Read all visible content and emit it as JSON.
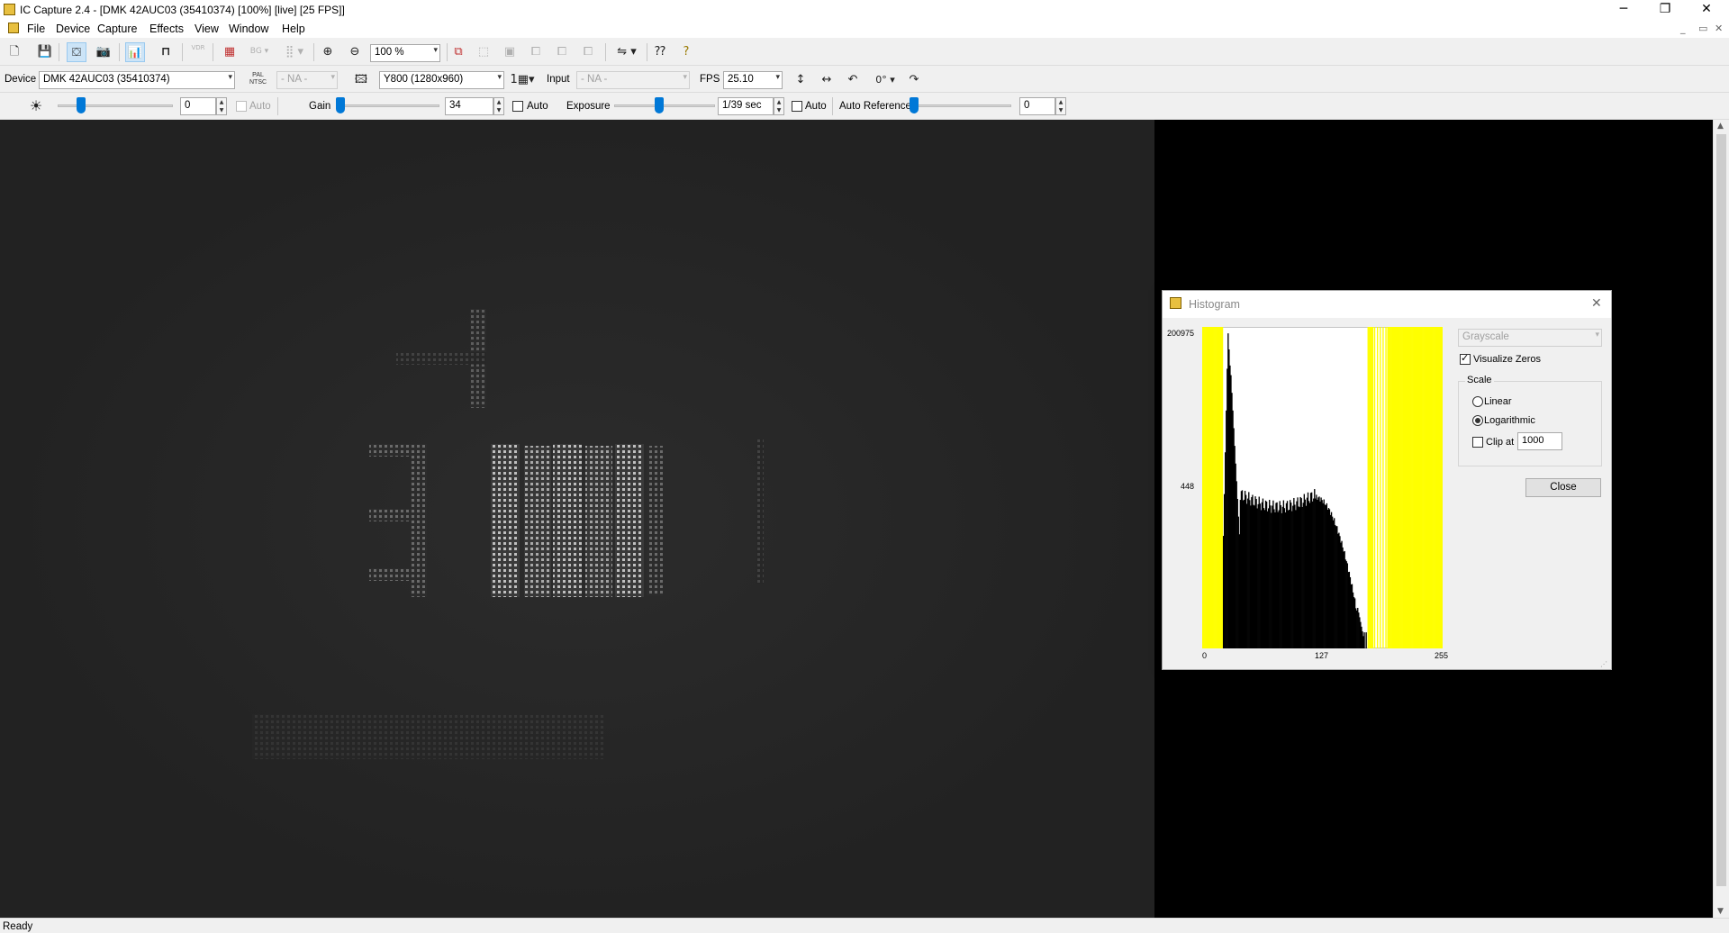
{
  "window": {
    "title": "IC Capture 2.4 - [DMK 42AUC03 (35410374) [100%]  [live]  [25 FPS]]",
    "minimize_glyph": "─",
    "maximize_glyph": "❐",
    "close_glyph": "✕"
  },
  "menu": {
    "items": [
      "File",
      "Device",
      "Capture",
      "Effects",
      "View",
      "Window",
      "Help"
    ],
    "mdi_minimize": "_",
    "mdi_restore": "▭",
    "mdi_close": "✕"
  },
  "toolbar1": {
    "buttons": [
      "new-icon",
      "save-icon",
      "live-video-icon",
      "snapshot-icon",
      "histogram-icon",
      "trigger-icon",
      "vdr-icon",
      "bayer-icon",
      "bg-icon",
      "grid-icon",
      "zoom-in-icon",
      "zoom-out-icon"
    ],
    "vdr_label": "VDR",
    "bg_label": "BG",
    "zoom": "100 %"
  },
  "toolbar2": {
    "device_label": "Device",
    "device_value": "DMK 42AUC03 (35410374)",
    "pal_label": "PAL",
    "ntsc_label": "NTSC",
    "video_norm_value": "- NA -",
    "format_value": "Y800 (1280x960)",
    "input_label": "Input",
    "input_value": "- NA -",
    "fps_label": "FPS",
    "fps_value": "25.10",
    "rotation_value": "0°"
  },
  "toolbar3": {
    "brightness_value": "0",
    "brightness_level": 0.2,
    "brightness_auto_label": "Auto",
    "gain_label": "Gain",
    "gain_value": "34",
    "gain_level": 0.0,
    "gain_auto_label": "Auto",
    "exposure_label": "Exposure",
    "exposure_value": "1/39 sec",
    "exposure_level": 0.45,
    "exposure_auto_label": "Auto",
    "autoref_label": "Auto Reference",
    "autoref_value": "0",
    "autoref_level": 0.0
  },
  "status": {
    "text": "Ready"
  },
  "histogram": {
    "title": "Histogram",
    "ymax_label": "200975",
    "ymid_label": "448",
    "x_ticks": [
      "0",
      "127",
      "255"
    ],
    "mode": "Grayscale",
    "visualize_zeros_label": "Visualize Zeros",
    "visualize_zeros_checked": true,
    "scale_group_label": "Scale",
    "linear_label": "Linear",
    "log_label": "Logarithmic",
    "selected_scale": "Logarithmic",
    "clip_label": "Clip at",
    "clip_checked": false,
    "clip_value": "1000",
    "close_label": "Close",
    "colors": {
      "zero_bins": "#ffff00",
      "bars": "#000000"
    }
  }
}
